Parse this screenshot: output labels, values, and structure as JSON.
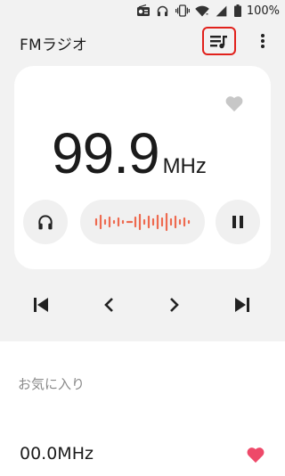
{
  "status_bar": {
    "battery": "100%"
  },
  "app_bar": {
    "title": "FMラジオ"
  },
  "player": {
    "frequency": "99.9",
    "unit": "MHz"
  },
  "favorites": {
    "section_label": "お気に入り",
    "items": [
      {
        "frequency": "00.0MHz"
      }
    ]
  },
  "colors": {
    "accent": "#e1211c",
    "wave": "#ee6a4f",
    "heart_active": "#ee4969",
    "heart_inactive": "#c7c7c7"
  }
}
